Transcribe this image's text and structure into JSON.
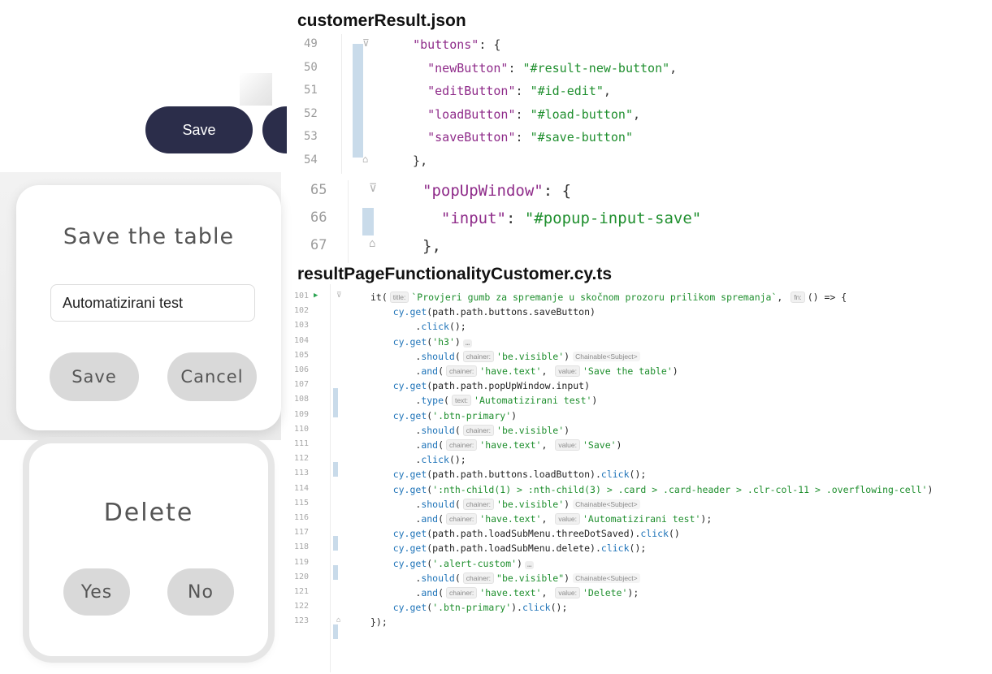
{
  "left_panel": {
    "top_button": {
      "label": "Save"
    },
    "save_modal": {
      "title": "Save the table",
      "input_value": "Automatizirani test",
      "save_label": "Save",
      "cancel_label": "Cancel"
    },
    "delete_modal": {
      "title": "Delete",
      "yes_label": "Yes",
      "no_label": "No"
    },
    "colors": {
      "primary_button": "#2b2d4a",
      "secondary_pill": "#d9d9d9"
    }
  },
  "file1": {
    "filename": "customerResult.json",
    "block_a": [
      {
        "num": "49",
        "fold": "open",
        "tokens": [
          [
            "pun",
            "  "
          ],
          [
            "key",
            "\"buttons\""
          ],
          [
            "pun",
            ": {"
          ]
        ]
      },
      {
        "num": "50",
        "tokens": [
          [
            "pun",
            "    "
          ],
          [
            "key",
            "\"newButton\""
          ],
          [
            "pun",
            ": "
          ],
          [
            "str",
            "\"#result-new-button\""
          ],
          [
            "pun",
            ","
          ]
        ]
      },
      {
        "num": "51",
        "tokens": [
          [
            "pun",
            "    "
          ],
          [
            "key",
            "\"editButton\""
          ],
          [
            "pun",
            ": "
          ],
          [
            "str",
            "\"#id-edit\""
          ],
          [
            "pun",
            ","
          ]
        ]
      },
      {
        "num": "52",
        "tokens": [
          [
            "pun",
            "    "
          ],
          [
            "key",
            "\"loadButton\""
          ],
          [
            "pun",
            ": "
          ],
          [
            "str",
            "\"#load-button\""
          ],
          [
            "pun",
            ","
          ]
        ]
      },
      {
        "num": "53",
        "tokens": [
          [
            "pun",
            "    "
          ],
          [
            "key",
            "\"saveButton\""
          ],
          [
            "pun",
            ": "
          ],
          [
            "str",
            "\"#save-button\""
          ]
        ]
      },
      {
        "num": "54",
        "fold": "close",
        "tokens": [
          [
            "pun",
            "  },"
          ]
        ]
      }
    ],
    "block_b": [
      {
        "num": "65",
        "fold": "open",
        "tokens": [
          [
            "key",
            "\"popUpWindow\""
          ],
          [
            "pun",
            ": {"
          ]
        ]
      },
      {
        "num": "66",
        "tokens": [
          [
            "pun",
            "  "
          ],
          [
            "key",
            "\"input\""
          ],
          [
            "pun",
            ": "
          ],
          [
            "str",
            "\"#popup-input-save\""
          ]
        ]
      },
      {
        "num": "67",
        "fold": "close",
        "tokens": [
          [
            "pun",
            "},"
          ]
        ]
      }
    ]
  },
  "file2": {
    "filename": "resultPageFunctionalityCustomer.cy.ts",
    "lines": [
      {
        "num": "101",
        "run": true,
        "fold": "open",
        "tokens": [
          [
            "plain",
            "it("
          ],
          [
            "hint",
            "title:"
          ],
          [
            "str",
            "`Provjeri gumb za spremanje u skočnom prozoru prilikom spremanja`"
          ],
          [
            "plain",
            ", "
          ],
          [
            "hint",
            "fn:"
          ],
          [
            "plain",
            "() => {"
          ]
        ]
      },
      {
        "num": "102",
        "tokens": [
          [
            "plain",
            "    "
          ],
          [
            "fn",
            "cy.get"
          ],
          [
            "plain",
            "(path.path.buttons.saveButton)"
          ]
        ]
      },
      {
        "num": "103",
        "tokens": [
          [
            "plain",
            "        ."
          ],
          [
            "fn",
            "click"
          ],
          [
            "plain",
            "();"
          ]
        ]
      },
      {
        "num": "104",
        "tokens": [
          [
            "plain",
            "    "
          ],
          [
            "fn",
            "cy.get"
          ],
          [
            "plain",
            "("
          ],
          [
            "str",
            "'h3'"
          ],
          [
            "plain",
            ")"
          ],
          [
            "collapsed",
            "…"
          ]
        ]
      },
      {
        "num": "105",
        "tokens": [
          [
            "plain",
            "        ."
          ],
          [
            "fn",
            "should"
          ],
          [
            "plain",
            "("
          ],
          [
            "hint",
            "chainer:"
          ],
          [
            "str",
            "'be.visible'"
          ],
          [
            "plain",
            ")"
          ],
          [
            "type",
            "Chainable<Subject>"
          ]
        ]
      },
      {
        "num": "106",
        "tokens": [
          [
            "plain",
            "        ."
          ],
          [
            "fn",
            "and"
          ],
          [
            "plain",
            "("
          ],
          [
            "hint",
            "chainer:"
          ],
          [
            "str",
            "'have.text'"
          ],
          [
            "plain",
            ", "
          ],
          [
            "hint",
            "value:"
          ],
          [
            "str",
            "'Save the table'"
          ],
          [
            "plain",
            ")"
          ]
        ]
      },
      {
        "num": "107",
        "tokens": [
          [
            "plain",
            "    "
          ],
          [
            "fn",
            "cy.get"
          ],
          [
            "plain",
            "(path.path.popUpWindow.input)"
          ]
        ]
      },
      {
        "num": "108",
        "tokens": [
          [
            "plain",
            "        ."
          ],
          [
            "fn",
            "type"
          ],
          [
            "plain",
            "("
          ],
          [
            "hint",
            "text:"
          ],
          [
            "str",
            "'Automatizirani test'"
          ],
          [
            "plain",
            ")"
          ]
        ]
      },
      {
        "num": "109",
        "tokens": [
          [
            "plain",
            "    "
          ],
          [
            "fn",
            "cy.get"
          ],
          [
            "plain",
            "("
          ],
          [
            "str",
            "'.btn-primary'"
          ],
          [
            "plain",
            ")"
          ]
        ]
      },
      {
        "num": "110",
        "tokens": [
          [
            "plain",
            "        ."
          ],
          [
            "fn",
            "should"
          ],
          [
            "plain",
            "("
          ],
          [
            "hint",
            "chainer:"
          ],
          [
            "str",
            "'be.visible'"
          ],
          [
            "plain",
            ")"
          ]
        ]
      },
      {
        "num": "111",
        "tokens": [
          [
            "plain",
            "        ."
          ],
          [
            "fn",
            "and"
          ],
          [
            "plain",
            "("
          ],
          [
            "hint",
            "chainer:"
          ],
          [
            "str",
            "'have.text'"
          ],
          [
            "plain",
            ", "
          ],
          [
            "hint",
            "value:"
          ],
          [
            "str",
            "'Save'"
          ],
          [
            "plain",
            ")"
          ]
        ]
      },
      {
        "num": "112",
        "tokens": [
          [
            "plain",
            "        ."
          ],
          [
            "fn",
            "click"
          ],
          [
            "plain",
            "();"
          ]
        ]
      },
      {
        "num": "113",
        "tokens": [
          [
            "plain",
            "    "
          ],
          [
            "fn",
            "cy.get"
          ],
          [
            "plain",
            "(path.path.buttons.loadButton)."
          ],
          [
            "fn",
            "click"
          ],
          [
            "plain",
            "();"
          ]
        ]
      },
      {
        "num": "114",
        "tokens": [
          [
            "plain",
            "    "
          ],
          [
            "fn",
            "cy.get"
          ],
          [
            "plain",
            "("
          ],
          [
            "str",
            "':nth-child(1) > :nth-child(3) > .card > .card-header > .clr-col-11 > .overflowing-cell'"
          ],
          [
            "plain",
            ")"
          ]
        ]
      },
      {
        "num": "115",
        "tokens": [
          [
            "plain",
            "        ."
          ],
          [
            "fn",
            "should"
          ],
          [
            "plain",
            "("
          ],
          [
            "hint",
            "chainer:"
          ],
          [
            "str",
            "'be.visible'"
          ],
          [
            "plain",
            ")"
          ],
          [
            "type",
            "Chainable<Subject>"
          ]
        ]
      },
      {
        "num": "116",
        "tokens": [
          [
            "plain",
            "        ."
          ],
          [
            "fn",
            "and"
          ],
          [
            "plain",
            "("
          ],
          [
            "hint",
            "chainer:"
          ],
          [
            "str",
            "'have.text'"
          ],
          [
            "plain",
            ", "
          ],
          [
            "hint",
            "value:"
          ],
          [
            "str",
            "'Automatizirani test'"
          ],
          [
            "plain",
            ");"
          ]
        ]
      },
      {
        "num": "117",
        "tokens": [
          [
            "plain",
            "    "
          ],
          [
            "fn",
            "cy.get"
          ],
          [
            "plain",
            "(path.path.loadSubMenu.threeDotSaved)."
          ],
          [
            "fn",
            "click"
          ],
          [
            "plain",
            "()"
          ]
        ]
      },
      {
        "num": "118",
        "tokens": [
          [
            "plain",
            "    "
          ],
          [
            "fn",
            "cy.get"
          ],
          [
            "plain",
            "(path.path.loadSubMenu.delete)."
          ],
          [
            "fn",
            "click"
          ],
          [
            "plain",
            "();"
          ]
        ]
      },
      {
        "num": "119",
        "tokens": [
          [
            "plain",
            "    "
          ],
          [
            "fn",
            "cy.get"
          ],
          [
            "plain",
            "("
          ],
          [
            "str",
            "'.alert-custom'"
          ],
          [
            "plain",
            ")"
          ],
          [
            "collapsed",
            "…"
          ]
        ]
      },
      {
        "num": "120",
        "tokens": [
          [
            "plain",
            "        ."
          ],
          [
            "fn",
            "should"
          ],
          [
            "plain",
            "("
          ],
          [
            "hint",
            "chainer:"
          ],
          [
            "str",
            "\"be.visible\""
          ],
          [
            "plain",
            ")"
          ],
          [
            "type",
            "Chainable<Subject>"
          ]
        ]
      },
      {
        "num": "121",
        "tokens": [
          [
            "plain",
            "        ."
          ],
          [
            "fn",
            "and"
          ],
          [
            "plain",
            "("
          ],
          [
            "hint",
            "chainer:"
          ],
          [
            "str",
            "'have.text'"
          ],
          [
            "plain",
            ", "
          ],
          [
            "hint",
            "value:"
          ],
          [
            "str",
            "'Delete'"
          ],
          [
            "plain",
            ");"
          ]
        ]
      },
      {
        "num": "122",
        "tokens": [
          [
            "plain",
            "    "
          ],
          [
            "fn",
            "cy.get"
          ],
          [
            "plain",
            "("
          ],
          [
            "str",
            "'.btn-primary'"
          ],
          [
            "plain",
            ")."
          ],
          [
            "fn",
            "click"
          ],
          [
            "plain",
            "();"
          ]
        ]
      },
      {
        "num": "123",
        "fold": "close",
        "tokens": [
          [
            "plain",
            "});"
          ]
        ]
      }
    ]
  }
}
